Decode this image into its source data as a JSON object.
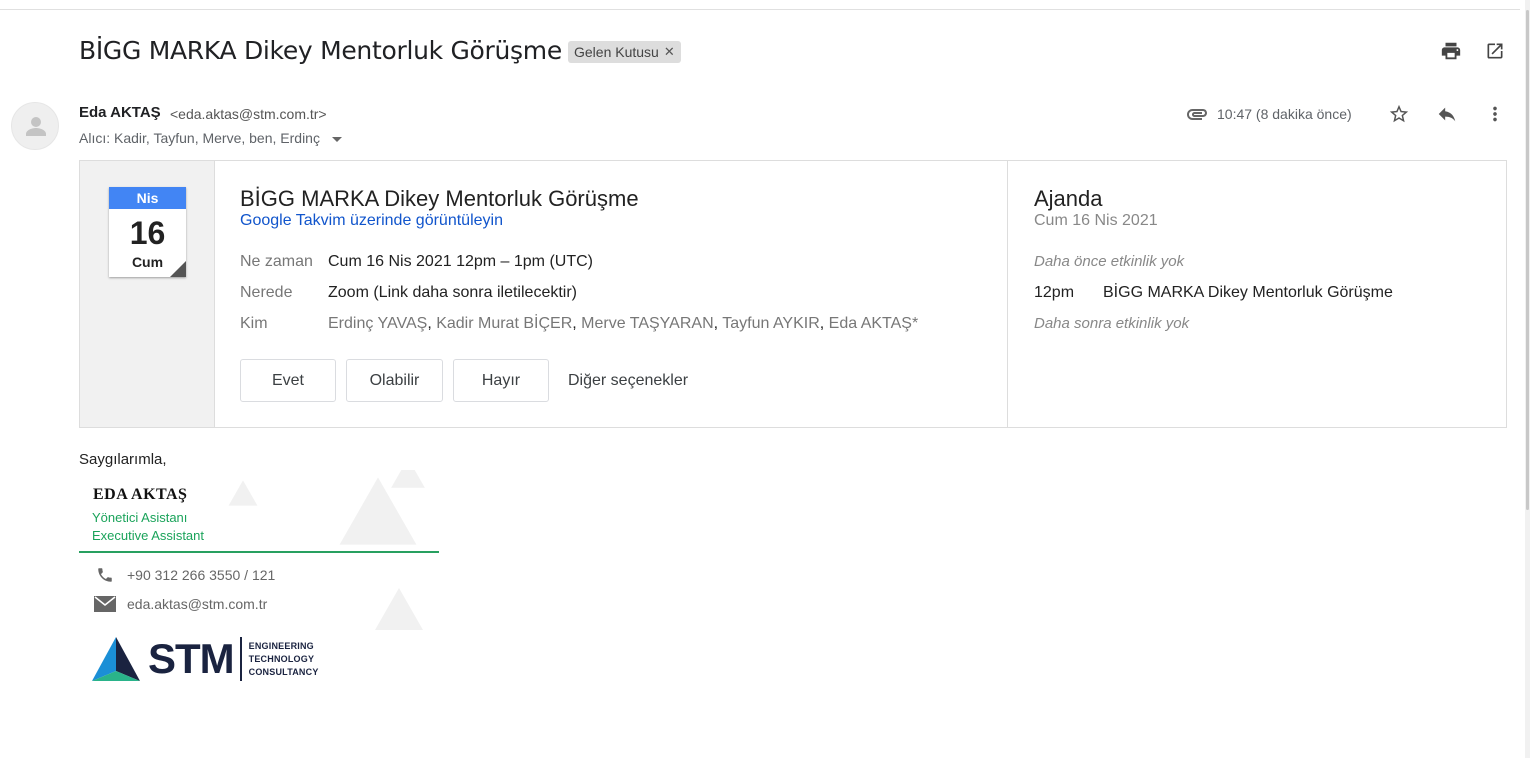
{
  "email": {
    "subject": "BİGG MARKA Dikey Mentorluk Görüşme",
    "label": "Gelen Kutusu",
    "sender_name": "Eda AKTAŞ",
    "sender_email": "<eda.aktas@stm.com.tr>",
    "recipients": "Alıcı: Kadir, Tayfun, Merve, ben, Erdinç",
    "time": "10:47 (8 dakika önce)",
    "icons": [
      "print-icon",
      "open-in-new-window-icon",
      "attachment-icon",
      "star-icon",
      "reply-icon",
      "more-vert-icon"
    ]
  },
  "invite": {
    "calendar": {
      "month": "Nis",
      "day": "16",
      "weekday": "Cum"
    },
    "title": "BİGG MARKA Dikey Mentorluk Görüşme",
    "view_link": "Google Takvim üzerinde görüntüleyin",
    "when_label": "Ne zaman",
    "when_value": "Cum 16 Nis 2021 12pm – 1pm (UTC)",
    "where_label": "Nerede",
    "where_value": "Zoom (Link daha sonra iletilecektir)",
    "who_label": "Kim",
    "guests": [
      "Erdinç YAVAŞ",
      "Kadir Murat BİÇER",
      "Merve TAŞYARAN",
      "Tayfun AYKIR",
      "Eda AKTAŞ*"
    ],
    "rsvp": {
      "yes": "Evet",
      "maybe": "Olabilir",
      "no": "Hayır",
      "more": "Diğer seçenekler"
    }
  },
  "agenda": {
    "title": "Ajanda",
    "date": "Cum 16 Nis 2021",
    "before": "Daha önce etkinlik yok",
    "event_time": "12pm",
    "event_title": "BİGG MARKA Dikey Mentorluk Görüşme",
    "after": "Daha sonra etkinlik yok"
  },
  "signature": {
    "sign_off": "Saygılarımla,",
    "name": "EDA AKTAŞ",
    "role_tr": "Yönetici Asistanı",
    "role_en": "Executive Assistant",
    "phone": "+90 312 266 3550 / 121",
    "email": "eda.aktas@stm.com.tr",
    "logo_text": "STM",
    "logo_tag": [
      "ENGINEERING",
      "TECHNOLOGY",
      "CONSULTANCY"
    ],
    "accent_color": "#1aa35a",
    "brand_color": "#1a2340"
  }
}
